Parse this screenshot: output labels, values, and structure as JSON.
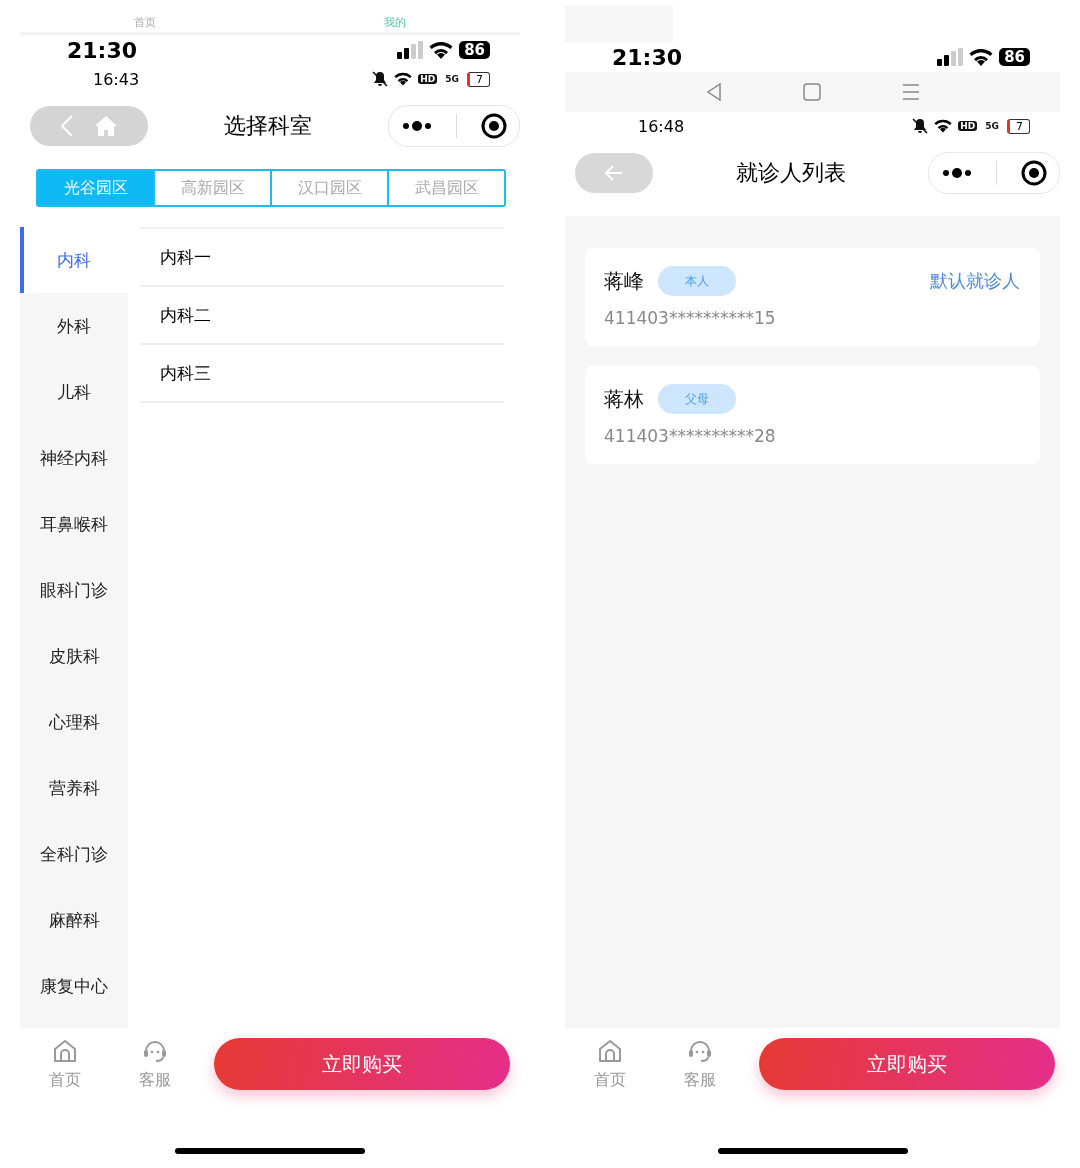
{
  "left_screen": {
    "top_tabs": [
      {
        "label": "首页",
        "selected": false
      },
      {
        "label": "我的",
        "selected": true
      }
    ],
    "status_bar": {
      "time": "21:30",
      "battery": "86"
    },
    "status_bar_2": {
      "time": "16:43",
      "badges": [
        "HD",
        "5G"
      ],
      "battery": "7"
    },
    "title": "选择科室",
    "campus_tabs": [
      {
        "label": "光谷园区",
        "selected": true
      },
      {
        "label": "高新园区",
        "selected": false
      },
      {
        "label": "汉口园区",
        "selected": false
      },
      {
        "label": "武昌园区",
        "selected": false
      }
    ],
    "departments": [
      {
        "label": "内科",
        "selected": true
      },
      {
        "label": "外科",
        "selected": false
      },
      {
        "label": "儿科",
        "selected": false
      },
      {
        "label": "神经内科",
        "selected": false
      },
      {
        "label": "耳鼻喉科",
        "selected": false
      },
      {
        "label": "眼科门诊",
        "selected": false
      },
      {
        "label": "皮肤科",
        "selected": false
      },
      {
        "label": "心理科",
        "selected": false
      },
      {
        "label": "营养科",
        "selected": false
      },
      {
        "label": "全科门诊",
        "selected": false
      },
      {
        "label": "麻醉科",
        "selected": false
      },
      {
        "label": "康复中心",
        "selected": false
      }
    ],
    "sub_departments": [
      "内科一",
      "内科二",
      "内科三"
    ],
    "bottom_bar": {
      "nav": [
        {
          "label": "首页",
          "kind": "home"
        },
        {
          "label": "客服",
          "kind": "service"
        }
      ],
      "button": "立即购买"
    }
  },
  "right_screen": {
    "status_bar": {
      "time": "21:30",
      "battery": "86"
    },
    "status_bar_2": {
      "time": "16:48",
      "badges": [
        "HD",
        "5G"
      ],
      "battery": "7"
    },
    "title": "就诊人列表",
    "patients": [
      {
        "name": "蒋峰",
        "tag": "本人",
        "id_number": "411403**********15",
        "action": "默认就诊人"
      },
      {
        "name": "蒋林",
        "tag": "父母",
        "id_number": "411403**********28"
      }
    ],
    "bottom_bar": {
      "nav": [
        {
          "label": "首页",
          "kind": "home"
        },
        {
          "label": "客服",
          "kind": "service"
        }
      ],
      "button": "立即购买"
    }
  }
}
